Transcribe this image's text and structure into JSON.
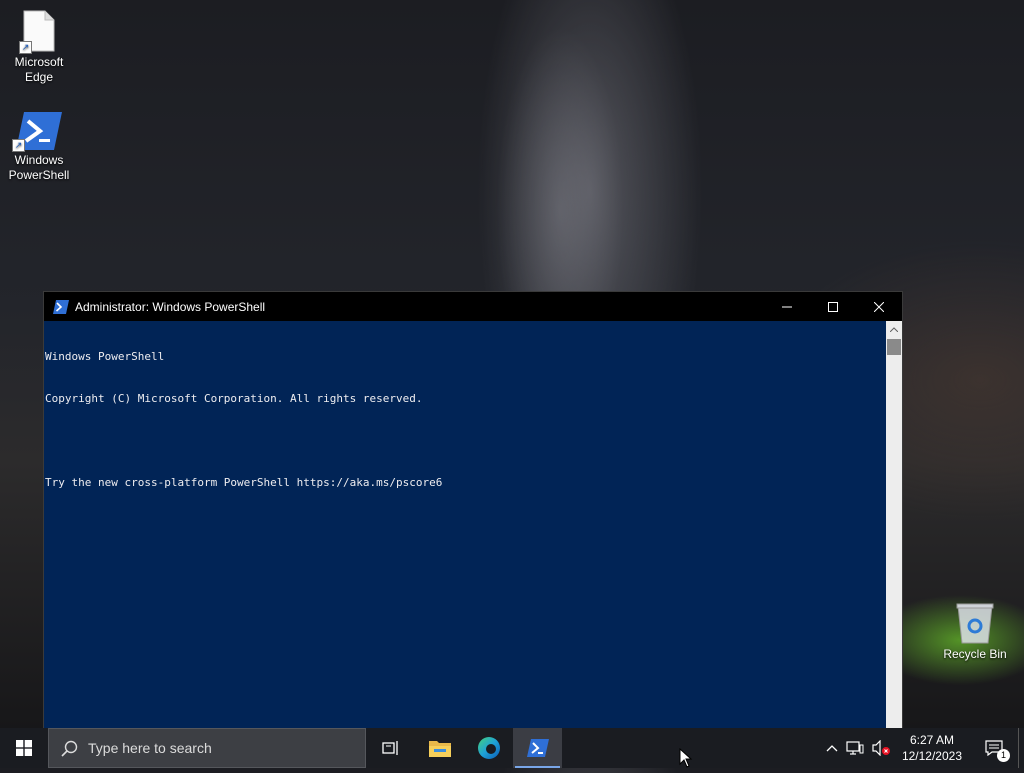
{
  "desktop": {
    "icons": [
      {
        "label": "Microsoft Edge"
      },
      {
        "label": "Windows PowerShell"
      },
      {
        "label": "Recycle Bin"
      }
    ]
  },
  "window": {
    "title": "Administrator: Windows PowerShell",
    "console_lines": [
      "Windows PowerShell",
      "Copyright (C) Microsoft Corporation. All rights reserved.",
      "",
      "Try the new cross-platform PowerShell https://aka.ms/pscore6"
    ],
    "background_color": "#012456"
  },
  "taskbar": {
    "search_placeholder": "Type here to search",
    "pinned_apps": [
      "task-view",
      "file-explorer",
      "microsoft-edge",
      "windows-powershell"
    ],
    "active_app": "windows-powershell",
    "clock_time": "6:27 AM",
    "clock_date": "12/12/2023",
    "notification_count": "1"
  }
}
